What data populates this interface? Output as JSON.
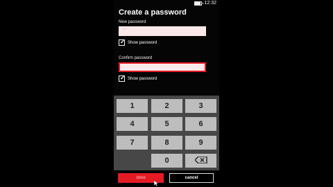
{
  "status_bar": {
    "battery_level": 0.8,
    "time": "12:32"
  },
  "page": {
    "title": "Create a password"
  },
  "new_password": {
    "label": "New password",
    "masked_value": "••",
    "show_password_label": "Show password",
    "show_password_checked": true
  },
  "confirm_password": {
    "label": "Confirm password",
    "masked_value": "",
    "show_password_label": "Show password",
    "show_password_checked": true
  },
  "keypad": {
    "keys": [
      "1",
      "2",
      "3",
      "4",
      "5",
      "6",
      "7",
      "8",
      "9",
      "0"
    ],
    "backspace_icon": "backspace-icon",
    "key_color": "#bdbdbd",
    "background_color": "#474747"
  },
  "actions": {
    "done_label": "done",
    "cancel_label": "cancel",
    "accent_color": "#e51b24"
  }
}
